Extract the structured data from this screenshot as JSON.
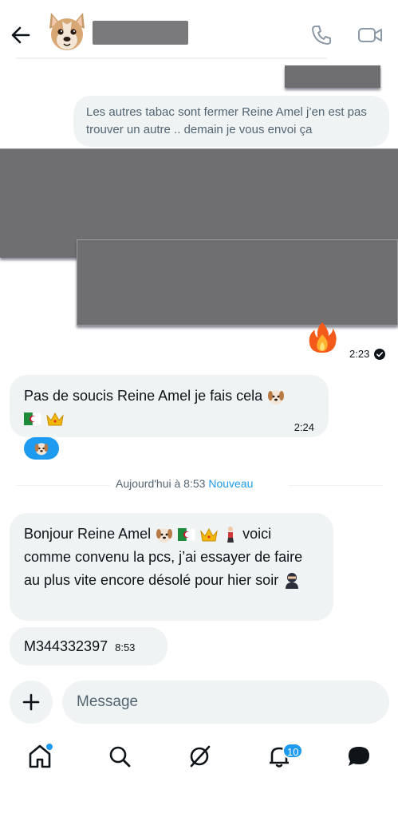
{
  "header": {
    "back_icon": "arrow-left-icon",
    "call_icon": "phone-icon",
    "video_icon": "video-camera-icon"
  },
  "messages": {
    "outgoing_text": "Les autres tabac sont fermer Reine Amel j’en est pas trouver un autre .. demain je vous envoi ça",
    "outgoing_time": "2:23",
    "incoming_1_text": "Pas de soucis Reine Amel je fais cela",
    "incoming_1_time": "2:24",
    "incoming_2_text_a": "Bonjour Reine Amel",
    "incoming_2_text_b": "voici comme convenu la pcs, j’ai essayer de faire au plus vite encore désolé pour hier soir",
    "incoming_3_text": "M344332397",
    "incoming_3_time": "8:53"
  },
  "divider": {
    "label": "Aujourd'hui à 8:53",
    "new_label": "Nouveau"
  },
  "composer": {
    "placeholder": "Message"
  },
  "nav": {
    "notifications_count": "10"
  },
  "colors": {
    "accent": "#1d9bf0",
    "bubble": "#eff3f4",
    "redaction": "#6f6f72"
  }
}
